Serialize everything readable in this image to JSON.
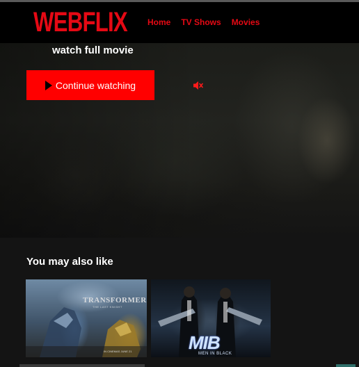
{
  "brand": {
    "logo_text": "WEBFLIX",
    "accent": "#e50914",
    "button_red": "#ff0000"
  },
  "nav": {
    "items": [
      {
        "label": "Home"
      },
      {
        "label": "TV Shows"
      },
      {
        "label": "Movies"
      }
    ]
  },
  "hero": {
    "subtitle": "watch full movie",
    "play_label": "Continue watching",
    "play_icon": "play-icon",
    "mute_icon": "speaker-muted-icon"
  },
  "recommendations": {
    "heading": "You may also like",
    "posters": [
      {
        "title": "TRANSFORMERS",
        "subtitle": "THE LAST KNIGHT",
        "date": "IN CINEMAS JUNE 21"
      },
      {
        "title": "MIB",
        "subtitle": "MEN IN BLACK"
      }
    ]
  }
}
